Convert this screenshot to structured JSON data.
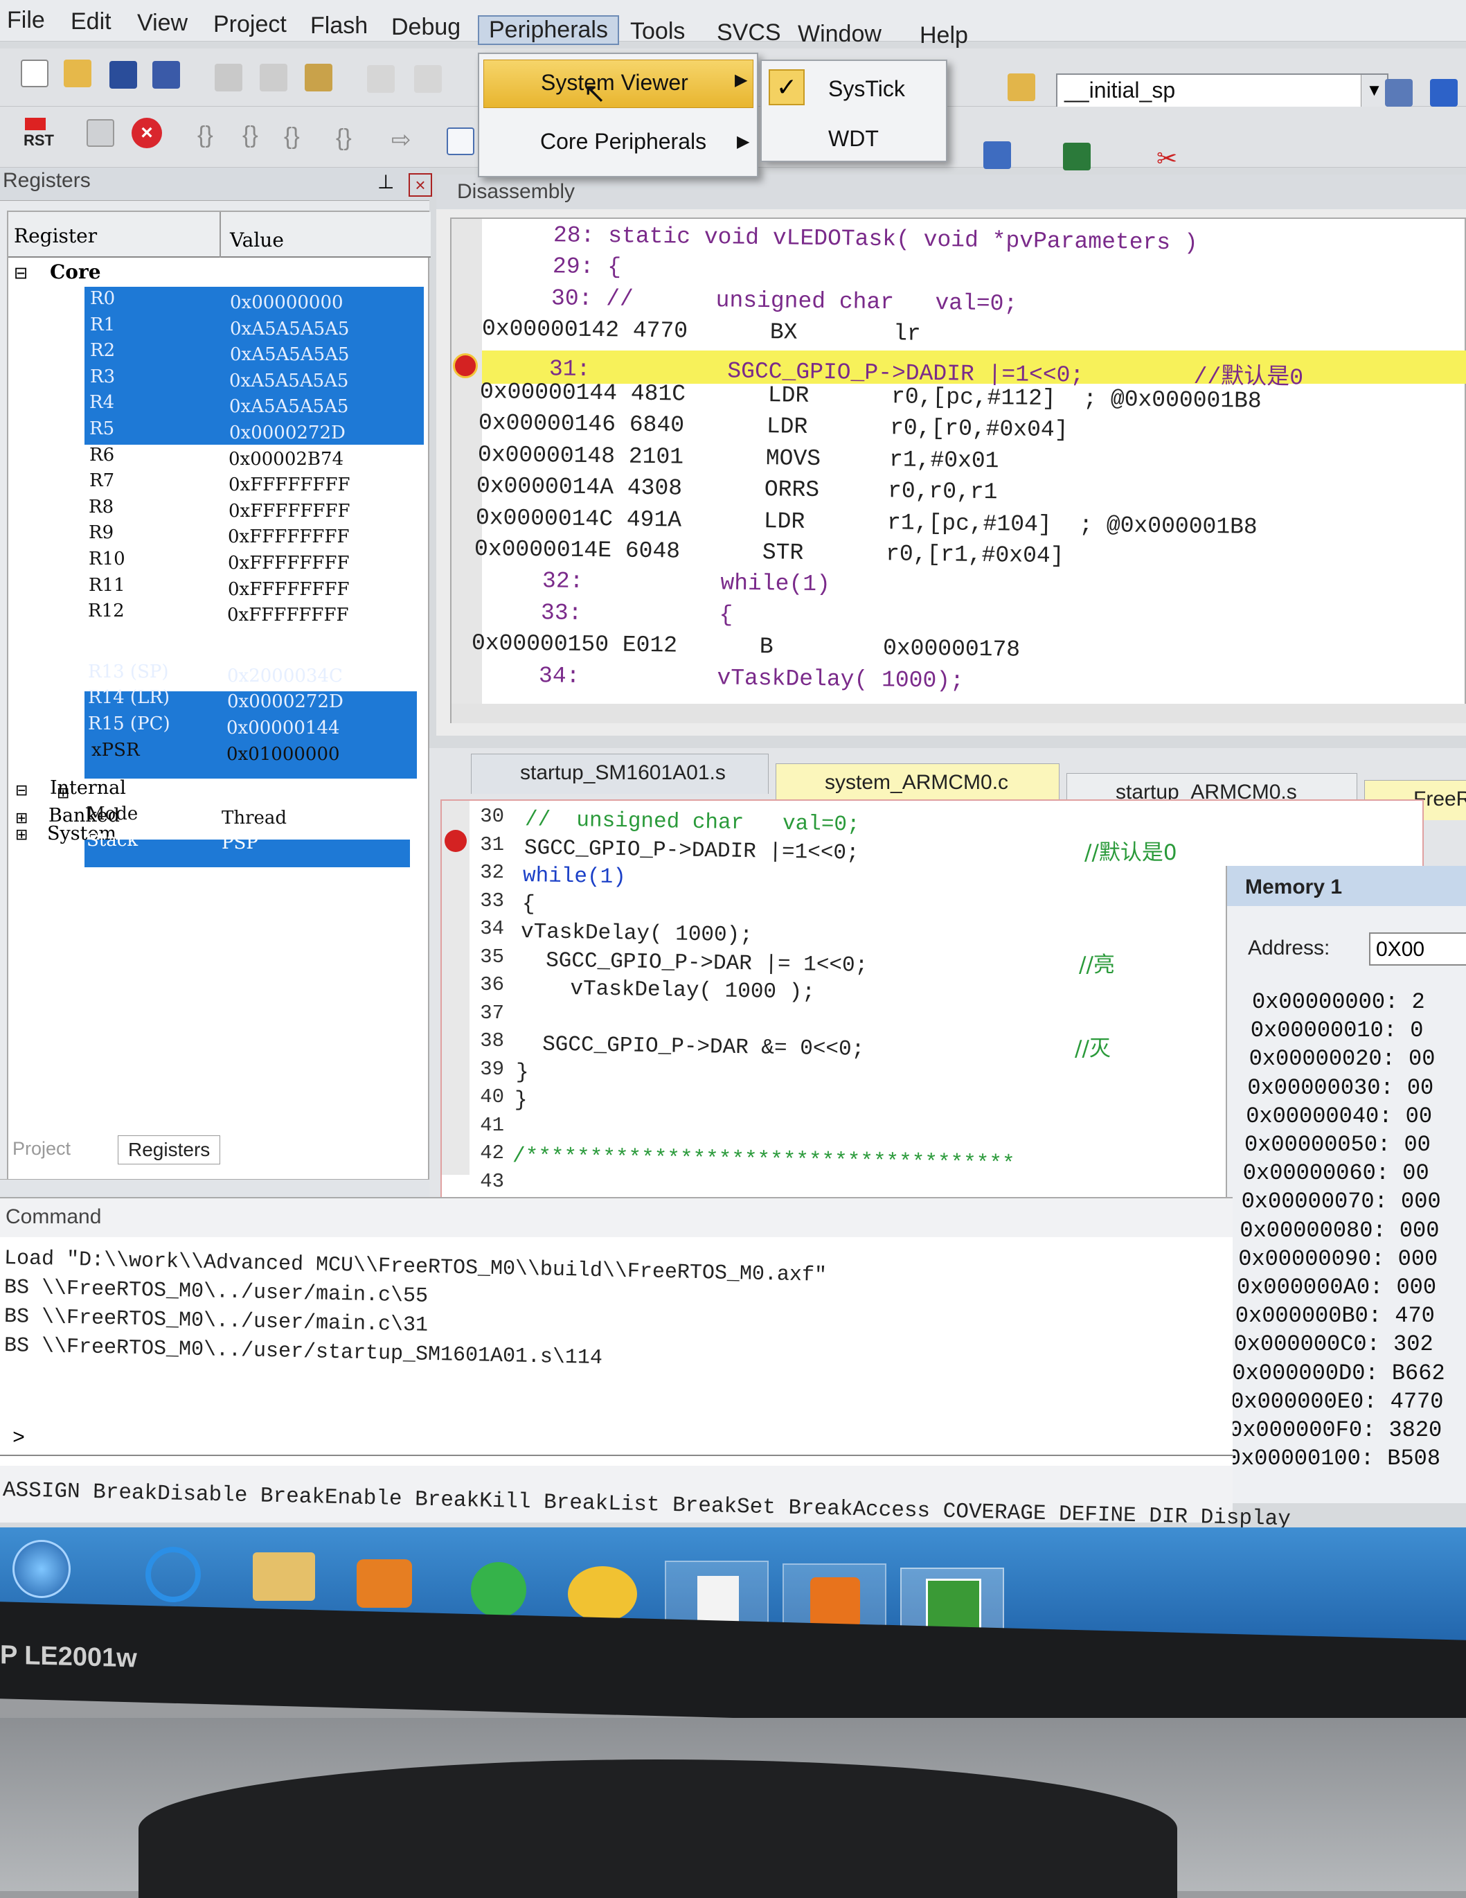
{
  "menu": [
    "File",
    "Edit",
    "View",
    "Project",
    "Flash",
    "Debug",
    "Peripherals",
    "Tools",
    "SVCS",
    "Window",
    "Help"
  ],
  "peripherals_menu": {
    "items": [
      "System Viewer",
      "Core Peripherals"
    ]
  },
  "system_viewer_submenu": {
    "items": [
      "SysTick",
      "WDT"
    ],
    "checked": "SysTick"
  },
  "toolbar": {
    "symbol_combo": "__initial_sp",
    "rst_label": "RST"
  },
  "registers_panel": {
    "title": "Registers",
    "col_register": "Register",
    "col_value": "Value",
    "groups": [
      "Core",
      "Banked",
      "System",
      "Internal"
    ],
    "core_rows": [
      {
        "name": "R0",
        "value": "0x00000000"
      },
      {
        "name": "R1",
        "value": "0xA5A5A5A5"
      },
      {
        "name": "R2",
        "value": "0xA5A5A5A5"
      },
      {
        "name": "R3",
        "value": "0xA5A5A5A5"
      },
      {
        "name": "R4",
        "value": "0xA5A5A5A5"
      },
      {
        "name": "R5",
        "value": "0x0000272D"
      },
      {
        "name": "R6",
        "value": "0x00002B74"
      },
      {
        "name": "R7",
        "value": "0xFFFFFFFF"
      },
      {
        "name": "R8",
        "value": "0xFFFFFFFF"
      },
      {
        "name": "R9",
        "value": "0xFFFFFFFF"
      },
      {
        "name": "R10",
        "value": "0xFFFFFFFF"
      },
      {
        "name": "R11",
        "value": "0xFFFFFFFF"
      },
      {
        "name": "R12",
        "value": "0xFFFFFFFF"
      },
      {
        "name": "R13 (SP)",
        "value": "0x2000034C"
      },
      {
        "name": "R14 (LR)",
        "value": "0x0000272D"
      },
      {
        "name": "R15 (PC)",
        "value": "0x00000144"
      },
      {
        "name": "xPSR",
        "value": "0x01000000"
      }
    ],
    "internal_rows": [
      {
        "name": "Mode",
        "value": "Thread"
      },
      {
        "name": "Stack",
        "value": "PSP"
      }
    ],
    "bottom_tabs": [
      "Project",
      "Registers"
    ]
  },
  "disassembly": {
    "title": "Disassembly",
    "lines": [
      "     28: static void vLEDOTask( void *pvParameters )",
      "     29: {",
      "     30: //      unsigned char   val=0;",
      "0x00000142 4770      BX       lr",
      "     31:          SGCC_GPIO_P->DADIR |=1<<0;        //默认是0",
      "0x00000144 481C      LDR      r0,[pc,#112]  ; @0x000001B8",
      "0x00000146 6840      LDR      r0,[r0,#0x04]",
      "0x00000148 2101      MOVS     r1,#0x01",
      "0x0000014A 4308      ORRS     r0,r0,r1",
      "0x0000014C 491A      LDR      r1,[pc,#104]  ; @0x000001B8",
      "0x0000014E 6048      STR      r0,[r1,#0x04]",
      "     32:          while(1)",
      "     33:          {",
      "0x00000150 E012      B        0x00000178",
      "     34:          vTaskDelay( 1000);"
    ]
  },
  "editor": {
    "tabs": [
      "startup_SM1601A01.s",
      "system_ARMCM0.c",
      "startup_ARMCM0.s",
      "FreeRTO"
    ],
    "lines": [
      {
        "n": "30",
        "code": "//  unsigned char   val=0;"
      },
      {
        "n": "31",
        "code": "SGCC_GPIO_P->DADIR |=1<<0;",
        "comment": "//默认是0"
      },
      {
        "n": "32",
        "code": "while(1)"
      },
      {
        "n": "33",
        "code": "{"
      },
      {
        "n": "34",
        "code": "vTaskDelay( 1000);"
      },
      {
        "n": "35",
        "code": "  SGCC_GPIO_P->DAR |= 1<<0;",
        "comment": "//亮"
      },
      {
        "n": "36",
        "code": "    vTaskDelay( 1000 );"
      },
      {
        "n": "37",
        "code": ""
      },
      {
        "n": "38",
        "code": "  SGCC_GPIO_P->DAR &= 0<<0;",
        "comment": "//灭"
      },
      {
        "n": "39",
        "code": "}"
      },
      {
        "n": "40",
        "code": "}"
      },
      {
        "n": "41",
        "code": ""
      },
      {
        "n": "42",
        "code": "/**************************************"
      },
      {
        "n": "43",
        "code": ""
      }
    ]
  },
  "memory": {
    "title": "Memory 1",
    "address_label": "Address:",
    "address_value": "0X00",
    "rows": [
      "0x00000000: 2",
      "0x00000010: 0",
      "0x00000020: 00",
      "0x00000030: 00",
      "0x00000040: 00",
      "0x00000050: 00",
      "0x00000060: 00",
      "0x00000070: 000",
      "0x00000080: 000",
      "0x00000090: 000",
      "0x000000A0: 000",
      "0x000000B0: 470",
      "0x000000C0: 302",
      "0x000000D0: B662",
      "0x000000E0: 4770",
      "0x000000F0: 3820",
      "0x00000100: B508"
    ]
  },
  "command": {
    "title": "Command",
    "lines": [
      "Load \"D:\\\\work\\\\Advanced MCU\\\\FreeRTOS_M0\\\\build\\\\FreeRTOS_M0.axf\"",
      "BS \\\\FreeRTOS_M0\\../user/main.c\\55",
      "BS \\\\FreeRTOS_M0\\../user/main.c\\31",
      "BS \\\\FreeRTOS_M0\\../user/startup_SM1601A01.s\\114"
    ],
    "prompt": ">",
    "hints": "ASSIGN BreakDisable BreakEnable BreakKill BreakList BreakSet BreakAccess COVERAGE DEFINE DIR Display"
  },
  "bezel": {
    "brand": "P LE2001w"
  }
}
